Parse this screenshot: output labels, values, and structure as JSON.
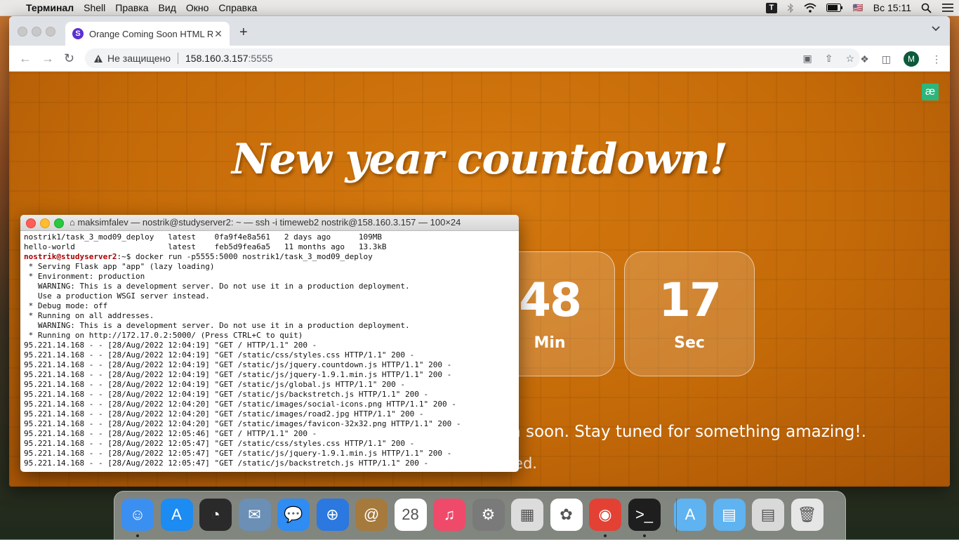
{
  "menubar": {
    "apple": "",
    "app_name": "Терминал",
    "items": [
      "Shell",
      "Правка",
      "Вид",
      "Окно",
      "Справка"
    ],
    "keyboard_badge": "T",
    "flag": "🇺🇸",
    "clock": "Вс 15:11"
  },
  "browser": {
    "tab_favicon": "S",
    "tab_title": "Orange Coming Soon HTML Re",
    "tab_close": "✕",
    "new_tab": "+",
    "security_text": "Не защищено",
    "url_host": "158.160.3.157",
    "url_port": ":5555",
    "profile_initial": "M"
  },
  "page": {
    "headline": "New year countdown!",
    "countdown": [
      {
        "value": "48",
        "label": "Min"
      },
      {
        "value": "17",
        "label": "Sec"
      }
    ],
    "tagline_partial": "on soon. Stay tuned for something amazing!.",
    "tagline2_partial": "ified.",
    "ext_icon": "æ"
  },
  "terminal": {
    "title": "maksimfalev — nostrik@studyserver2: ~ — ssh -i timeweb2 nostrik@158.160.3.157 — 100×24",
    "lines_before_prompt": [
      "nostrik1/task_3_mod09_deploy   latest    0fa9f4e8a561   2 days ago      109MB",
      "hello-world                    latest    feb5d9fea6a5   11 months ago   13.3kB"
    ],
    "prompt": "nostrik@studyserver2",
    "prompt_suffix": ":~$ ",
    "command": "docker run -p5555:5000 nostrik1/task_3_mod09_deploy",
    "output": [
      " * Serving Flask app \"app\" (lazy loading)",
      " * Environment: production",
      "   WARNING: This is a development server. Do not use it in a production deployment.",
      "   Use a production WSGI server instead.",
      " * Debug mode: off",
      " * Running on all addresses.",
      "   WARNING: This is a development server. Do not use it in a production deployment.",
      " * Running on http://172.17.0.2:5000/ (Press CTRL+C to quit)",
      "95.221.14.168 - - [28/Aug/2022 12:04:19] \"GET / HTTP/1.1\" 200 -",
      "95.221.14.168 - - [28/Aug/2022 12:04:19] \"GET /static/css/styles.css HTTP/1.1\" 200 -",
      "95.221.14.168 - - [28/Aug/2022 12:04:19] \"GET /static/js/jquery.countdown.js HTTP/1.1\" 200 -",
      "95.221.14.168 - - [28/Aug/2022 12:04:19] \"GET /static/js/jquery-1.9.1.min.js HTTP/1.1\" 200 -",
      "95.221.14.168 - - [28/Aug/2022 12:04:19] \"GET /static/js/global.js HTTP/1.1\" 200 -",
      "95.221.14.168 - - [28/Aug/2022 12:04:19] \"GET /static/js/backstretch.js HTTP/1.1\" 200 -",
      "95.221.14.168 - - [28/Aug/2022 12:04:20] \"GET /static/images/social-icons.png HTTP/1.1\" 200 -",
      "95.221.14.168 - - [28/Aug/2022 12:04:20] \"GET /static/images/road2.jpg HTTP/1.1\" 200 -",
      "95.221.14.168 - - [28/Aug/2022 12:04:20] \"GET /static/images/favicon-32x32.png HTTP/1.1\" 200 -",
      "95.221.14.168 - - [28/Aug/2022 12:05:46] \"GET / HTTP/1.1\" 200 -",
      "95.221.14.168 - - [28/Aug/2022 12:05:47] \"GET /static/css/styles.css HTTP/1.1\" 200 -",
      "95.221.14.168 - - [28/Aug/2022 12:05:47] \"GET /static/js/jquery-1.9.1.min.js HTTP/1.1\" 200 -",
      "95.221.14.168 - - [28/Aug/2022 12:05:47] \"GET /static/js/backstretch.js HTTP/1.1\" 200 -"
    ]
  },
  "dock": {
    "items": [
      {
        "name": "finder-icon",
        "glyph": "☺",
        "color": "#3b8ff0",
        "running": true
      },
      {
        "name": "app-store-icon",
        "glyph": "A",
        "color": "#1c8bf2",
        "running": false
      },
      {
        "name": "dashboard-icon",
        "glyph": "◔",
        "color": "#2a2a2a",
        "running": false
      },
      {
        "name": "mail-stamp-icon",
        "glyph": "✉",
        "color": "#6b8fb5",
        "running": false
      },
      {
        "name": "messages-icon",
        "glyph": "💬",
        "color": "#2f8cf2",
        "running": false
      },
      {
        "name": "safari-icon",
        "glyph": "⊕",
        "color": "#2a78e0",
        "running": false
      },
      {
        "name": "contacts-icon",
        "glyph": "@",
        "color": "#a57a3c",
        "running": false
      },
      {
        "name": "calendar-icon",
        "glyph": "28",
        "color": "#ffffff",
        "running": false
      },
      {
        "name": "music-icon",
        "glyph": "♫",
        "color": "#f04a6b",
        "running": false
      },
      {
        "name": "system-preferences-icon",
        "glyph": "⚙",
        "color": "#7a7a7a",
        "running": false
      },
      {
        "name": "preview-icon",
        "glyph": "▦",
        "color": "#dcdcdc",
        "running": false
      },
      {
        "name": "photos-icon",
        "glyph": "✿",
        "color": "#ffffff",
        "running": false
      },
      {
        "name": "chrome-icon",
        "glyph": "◉",
        "color": "#e34133",
        "running": true
      },
      {
        "name": "terminal-icon",
        "glyph": ">_",
        "color": "#1e1e1e",
        "running": true
      },
      {
        "name": "applications-folder-icon",
        "glyph": "A",
        "color": "#5fb3f0",
        "running": false
      },
      {
        "name": "documents-folder-icon",
        "glyph": "▤",
        "color": "#5fb3f0",
        "running": false
      },
      {
        "name": "downloads-icon",
        "glyph": "▤",
        "color": "#d9d9d9",
        "running": false
      },
      {
        "name": "trash-icon",
        "glyph": "🗑",
        "color": "#e6e6e6",
        "running": false
      }
    ]
  },
  "colors": {
    "page_orange": "#c46a08",
    "prompt_red": "#aa0000"
  }
}
